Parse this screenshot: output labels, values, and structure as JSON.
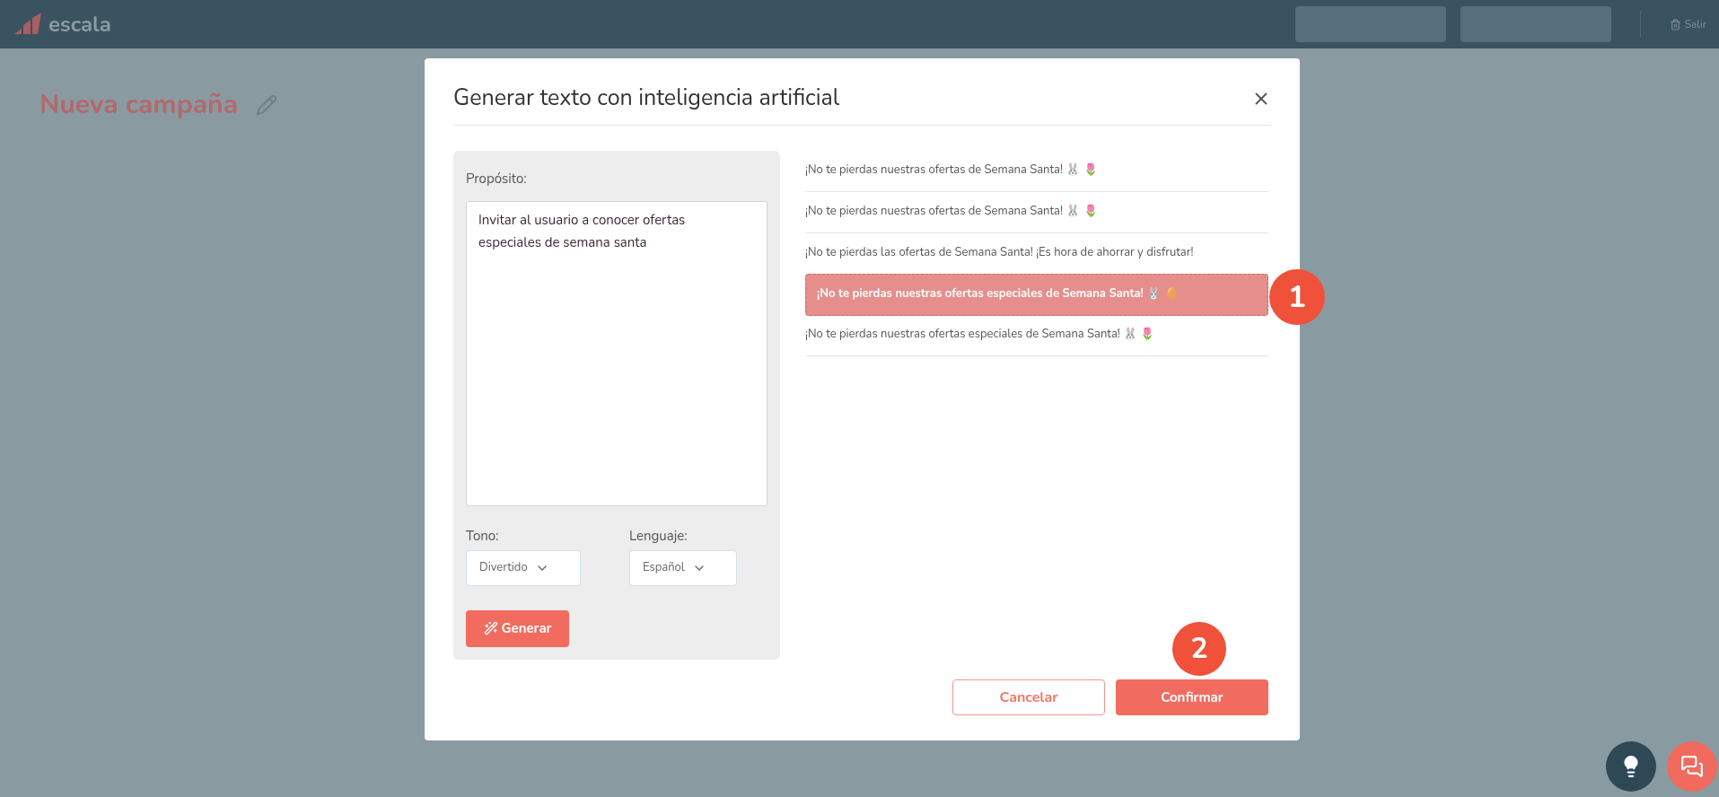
{
  "header": {
    "brand": "escala",
    "logout": "Salir"
  },
  "page": {
    "title": "Nueva campaña"
  },
  "dialog": {
    "title": "Generar texto con inteligencia artificial",
    "purpose": {
      "label": "Propósito:",
      "value": "Invitar al usuario a conocer ofertas especiales de semana santa"
    },
    "tone": {
      "label": "Tono:",
      "value": "Divertido"
    },
    "language": {
      "label": "Lenguaje:",
      "value": "Español"
    },
    "generate": "Generar",
    "suggestions": [
      {
        "text": "¡No te pierdas nuestras ofertas de Semana Santa! 🐰 🌷",
        "selected": false
      },
      {
        "text": "¡No te pierdas nuestras ofertas de Semana Santa! 🐰 🌷",
        "selected": false
      },
      {
        "text": "¡No te pierdas las ofertas de Semana Santa! ¡Es hora de ahorrar y disfrutar!",
        "selected": false
      },
      {
        "text": "¡No te pierdas nuestras ofertas especiales de Semana Santa! 🐰 🥚",
        "selected": true
      },
      {
        "text": "¡No te pierdas nuestras ofertas especiales de Semana Santa! 🐰 🌷",
        "selected": false
      }
    ],
    "cancel": "Cancelar",
    "confirm": "Confirmar"
  },
  "markers": [
    "1",
    "2"
  ]
}
